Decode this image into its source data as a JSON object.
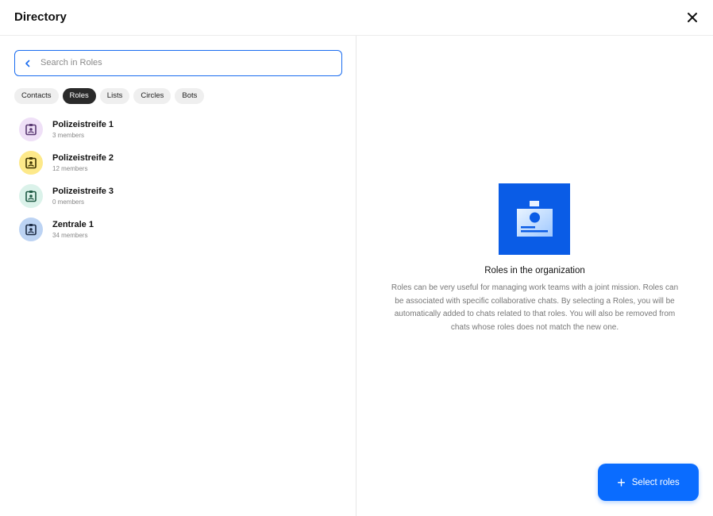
{
  "header": {
    "title": "Directory",
    "close_icon": "close-icon"
  },
  "search": {
    "placeholder": "Search in Roles",
    "value": ""
  },
  "filters": [
    {
      "label": "Contacts",
      "active": false
    },
    {
      "label": "Roles",
      "active": true
    },
    {
      "label": "Lists",
      "active": false
    },
    {
      "label": "Circles",
      "active": false
    },
    {
      "label": "Bots",
      "active": false
    }
  ],
  "roles": [
    {
      "name": "Polizeistreife 1",
      "members": "3 members",
      "avatar_bg": "#efe0f7",
      "icon_color": "#5b3a73"
    },
    {
      "name": "Polizeistreife 2",
      "members": "12 members",
      "avatar_bg": "#fde98a",
      "icon_color": "#3d3300"
    },
    {
      "name": "Polizeistreife 3",
      "members": "0 members",
      "avatar_bg": "#dbf2ea",
      "icon_color": "#1f5a44"
    },
    {
      "name": "Zentrale 1",
      "members": "34 members",
      "avatar_bg": "#bcd3f3",
      "icon_color": "#1d2c45"
    }
  ],
  "info": {
    "title": "Roles in the organization",
    "text": "Roles can be very useful for managing work teams with a joint mission. Roles can be associated with specific collaborative chats. By selecting a Roles, you will be automatically added to chats related to that roles. You will also be removed from chats whose roles does not match the new one."
  },
  "fab": {
    "label": "Select roles",
    "icon": "plus-icon"
  },
  "colors": {
    "accent": "#0a6cff",
    "hero": "#0a5ce6"
  }
}
